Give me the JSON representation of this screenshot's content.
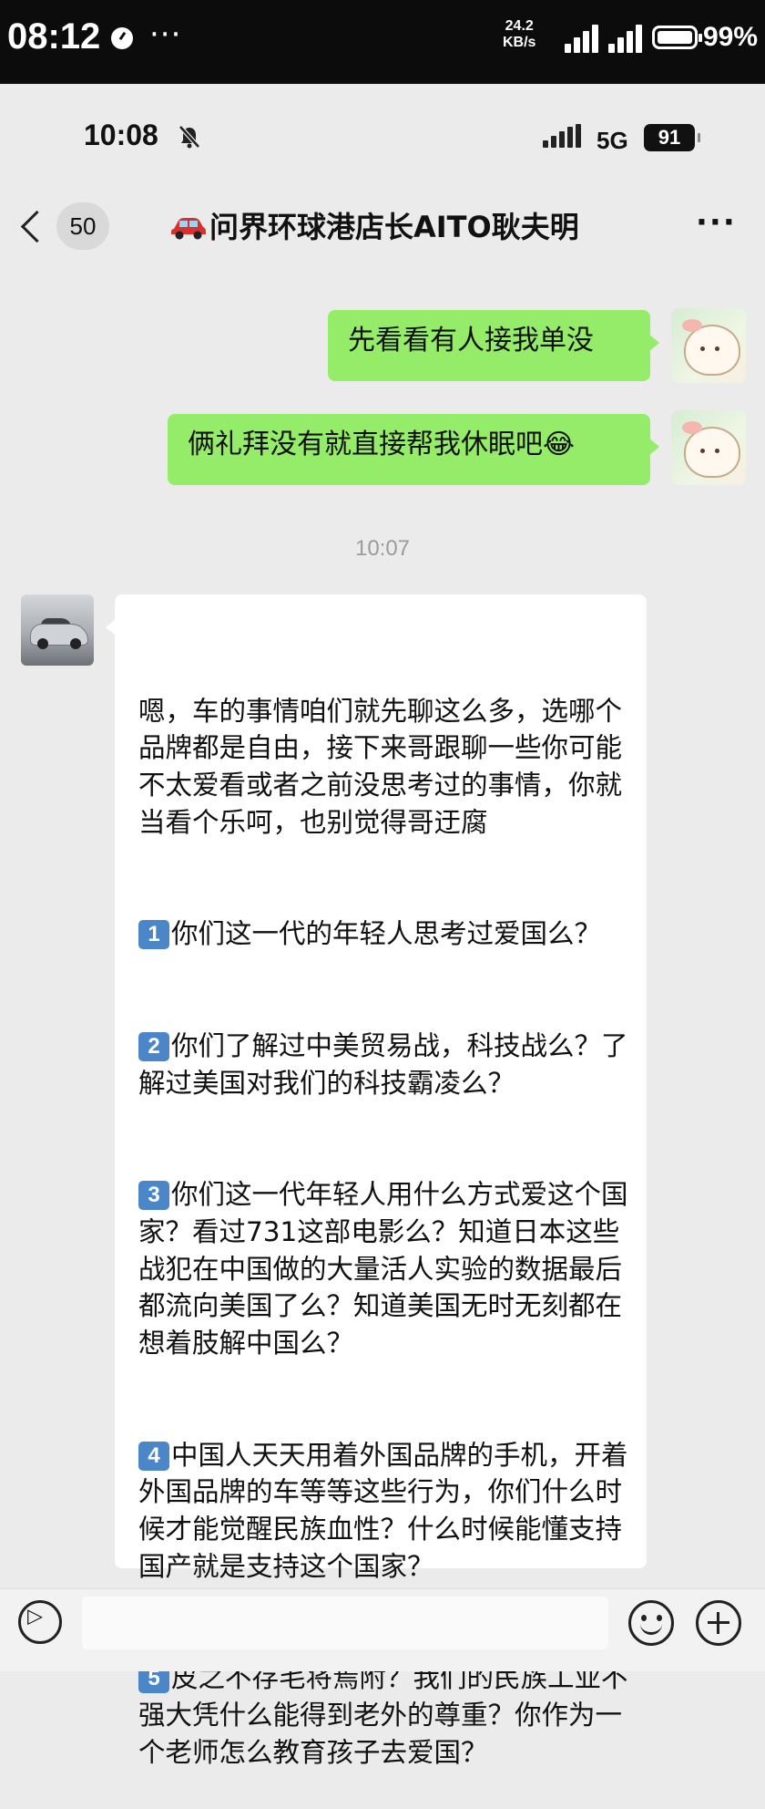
{
  "outer_status": {
    "time": "08:12",
    "more": "···",
    "speed_value": "24.2",
    "speed_unit": "KB/s",
    "battery": "99%"
  },
  "inner_status": {
    "time": "10:08",
    "network": "5G",
    "battery": "91"
  },
  "chat": {
    "unread_count": "50",
    "title": "问界环球港店长AITO耿夫明",
    "more": "···"
  },
  "messages_out": [
    {
      "text": "先看看有人接我单没"
    },
    {
      "text": "俩礼拜没有就直接帮我休眠吧😂"
    }
  ],
  "timestamp": "10:07",
  "message_in": {
    "intro": "嗯，车的事情咱们就先聊这么多，选哪个品牌都是自由，接下来哥跟聊一些你可能不太爱看或者之前没思考过的事情，你就当看个乐呵，也别觉得哥迂腐",
    "points": [
      {
        "num": "1",
        "text": "你们这一代的年轻人思考过爱国么？"
      },
      {
        "num": "2",
        "text": "你们了解过中美贸易战，科技战么？了解过美国对我们的科技霸凌么？"
      },
      {
        "num": "3",
        "text": "你们这一代年轻人用什么方式爱这个国家？看过731这部电影么？知道日本这些战犯在中国做的大量活人实验的数据最后都流向美国了么？知道美国无时无刻都在想着肢解中国么？"
      },
      {
        "num": "4",
        "text": "中国人天天用着外国品牌的手机，开着外国品牌的车等等这些行为，你们什么时候才能觉醒民族血性？什么时候能懂支持国产就是支持这个国家？"
      },
      {
        "num": "5",
        "text": "皮之不存毛将焉附？我们的民族工业不强大凭什么能得到老外的尊重？你作为一个老师怎么教育孩子去爱国？"
      }
    ]
  },
  "icons": {
    "outer": [
      "clock-icon",
      "signal-icon",
      "battery-icon"
    ],
    "inner": [
      "mute-bell-icon",
      "signal-icon",
      "battery-icon"
    ],
    "nav": [
      "back-icon",
      "car-icon",
      "more-icon"
    ],
    "bottom": [
      "voice-icon",
      "emoji-icon",
      "plus-icon"
    ]
  },
  "colors": {
    "outgoing_bubble": "#95ec69",
    "incoming_bubble": "#ffffff",
    "chat_background": "#ebebeb",
    "number_badge": "#4a86c8"
  }
}
